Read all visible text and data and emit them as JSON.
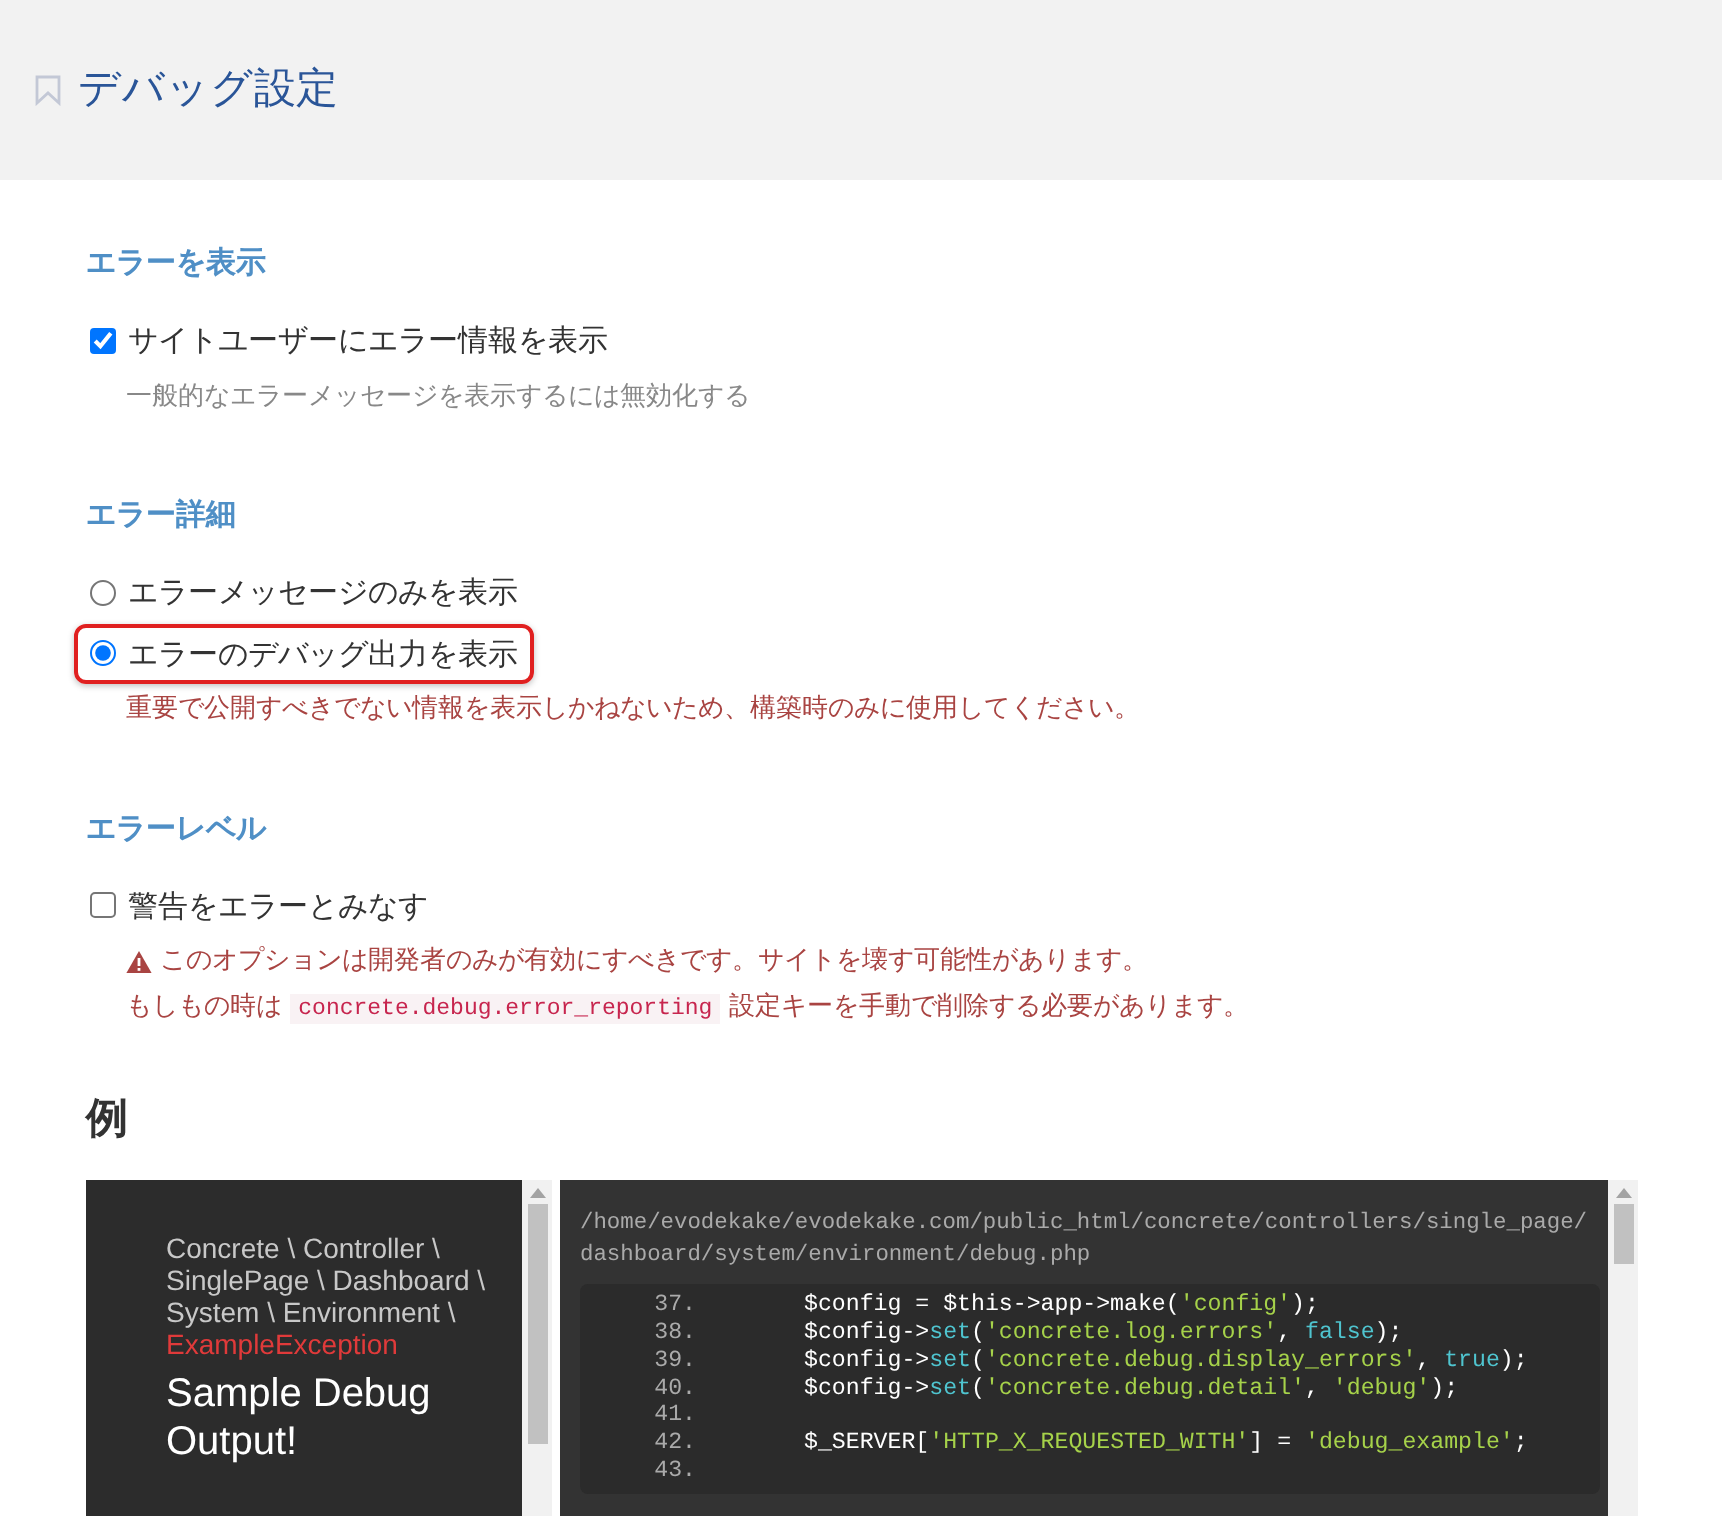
{
  "header": {
    "title": "デバッグ設定"
  },
  "sections": [
    {
      "heading": "エラーを表示",
      "kind": "checkbox",
      "options": [
        {
          "label": "サイトユーザーにエラー情報を表示",
          "checked": true,
          "highlighted": false
        }
      ],
      "help": [
        {
          "kind": "muted",
          "text": "一般的なエラーメッセージを表示するには無効化する"
        }
      ]
    },
    {
      "heading": "エラー詳細",
      "kind": "radio",
      "options": [
        {
          "label": "エラーメッセージのみを表示",
          "selected": false,
          "highlighted": false
        },
        {
          "label": "エラーのデバッグ出力を表示",
          "selected": true,
          "highlighted": true
        }
      ],
      "help": [
        {
          "kind": "danger",
          "text": "重要で公開すべきでない情報を表示しかねないため、構築時のみに使用してください。"
        }
      ]
    },
    {
      "heading": "エラーレベル",
      "kind": "checkbox",
      "options": [
        {
          "label": "警告をエラーとみなす",
          "checked": false,
          "highlighted": false
        }
      ],
      "help": [
        {
          "kind": "warning",
          "text": "このオプションは開発者のみが有効にすべきです。サイトを壊す可能性があります。"
        },
        {
          "kind": "code",
          "before": "もしもの時は",
          "code": "concrete.debug.error_reporting",
          "after": "設定キーを手動で削除する必要があります。"
        }
      ]
    }
  ],
  "example": {
    "heading": "例",
    "namespace": "Concrete \\ Controller \\ SinglePage \\ Dashboard \\ System \\ Environment \\",
    "exception_class": "ExampleException",
    "message": "Sample Debug Output!",
    "file_path": "/home/evodekake/evodekake.com/public_html/concrete/controllers/single_page/dashboard/system/environment/debug.php",
    "code_lines": [
      {
        "number": "37.",
        "tokens": [
          {
            "kind": "plain",
            "text": "$config = $this->app->make("
          },
          {
            "kind": "string",
            "text": "'config'"
          },
          {
            "kind": "plain",
            "text": ");"
          }
        ]
      },
      {
        "number": "38.",
        "tokens": [
          {
            "kind": "plain",
            "text": "$config->"
          },
          {
            "kind": "method",
            "text": "set"
          },
          {
            "kind": "plain",
            "text": "("
          },
          {
            "kind": "string",
            "text": "'concrete.log.errors'"
          },
          {
            "kind": "plain",
            "text": ", "
          },
          {
            "kind": "method",
            "text": "false"
          },
          {
            "kind": "plain",
            "text": ");"
          }
        ]
      },
      {
        "number": "39.",
        "tokens": [
          {
            "kind": "plain",
            "text": "$config->"
          },
          {
            "kind": "method",
            "text": "set"
          },
          {
            "kind": "plain",
            "text": "("
          },
          {
            "kind": "string",
            "text": "'concrete.debug.display_errors'"
          },
          {
            "kind": "plain",
            "text": ", "
          },
          {
            "kind": "method",
            "text": "true"
          },
          {
            "kind": "plain",
            "text": ");"
          }
        ]
      },
      {
        "number": "40.",
        "tokens": [
          {
            "kind": "plain",
            "text": "$config->"
          },
          {
            "kind": "method",
            "text": "set"
          },
          {
            "kind": "plain",
            "text": "("
          },
          {
            "kind": "string",
            "text": "'concrete.debug.detail'"
          },
          {
            "kind": "plain",
            "text": ", "
          },
          {
            "kind": "string",
            "text": "'debug'"
          },
          {
            "kind": "plain",
            "text": ");"
          }
        ]
      },
      {
        "number": "41."
      },
      {
        "number": "42.",
        "tokens": [
          {
            "kind": "plain",
            "text": "$_SERVER["
          },
          {
            "kind": "string",
            "text": "'HTTP_X_REQUESTED_WITH'"
          },
          {
            "kind": "plain",
            "text": "] = "
          },
          {
            "kind": "string",
            "text": "'debug_example'"
          },
          {
            "kind": "plain",
            "text": ";"
          }
        ]
      },
      {
        "number": "43."
      }
    ]
  }
}
